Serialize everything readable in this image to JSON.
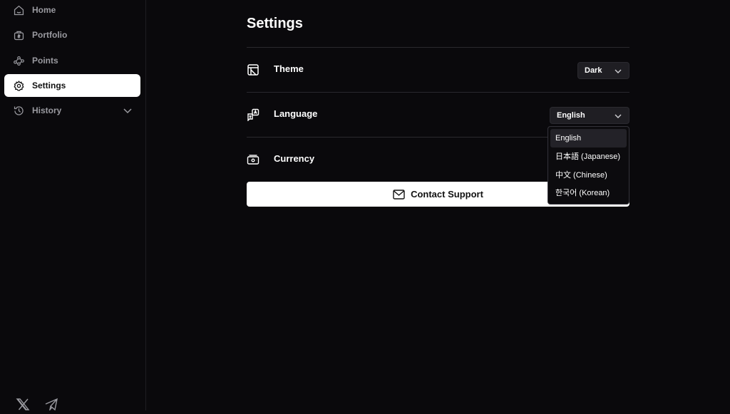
{
  "sidebar": {
    "items": [
      {
        "label": "Home",
        "icon": "home-icon"
      },
      {
        "label": "Portfolio",
        "icon": "portfolio-icon"
      },
      {
        "label": "Points",
        "icon": "points-icon"
      },
      {
        "label": "Settings",
        "icon": "gear-icon",
        "active": true
      },
      {
        "label": "History",
        "icon": "history-icon",
        "expandable": true
      }
    ],
    "social": [
      "x-icon",
      "telegram-icon"
    ]
  },
  "main": {
    "title": "Settings",
    "rows": [
      {
        "label": "Theme",
        "icon": "theme-icon",
        "value": "Dark"
      },
      {
        "label": "Language",
        "icon": "language-icon",
        "value": "English"
      },
      {
        "label": "Currency",
        "icon": "currency-icon"
      }
    ],
    "support_label": "Contact Support"
  },
  "language_dropdown": {
    "selected": "English",
    "options": [
      "English",
      "日本語 (Japanese)",
      "中文 (Chinese)",
      "한국어 (Korean)"
    ]
  },
  "colors": {
    "background": "#0a090c",
    "active_nav": "#ffffff",
    "muted_text": "#9a9aa0",
    "divider": "#2a292e"
  }
}
